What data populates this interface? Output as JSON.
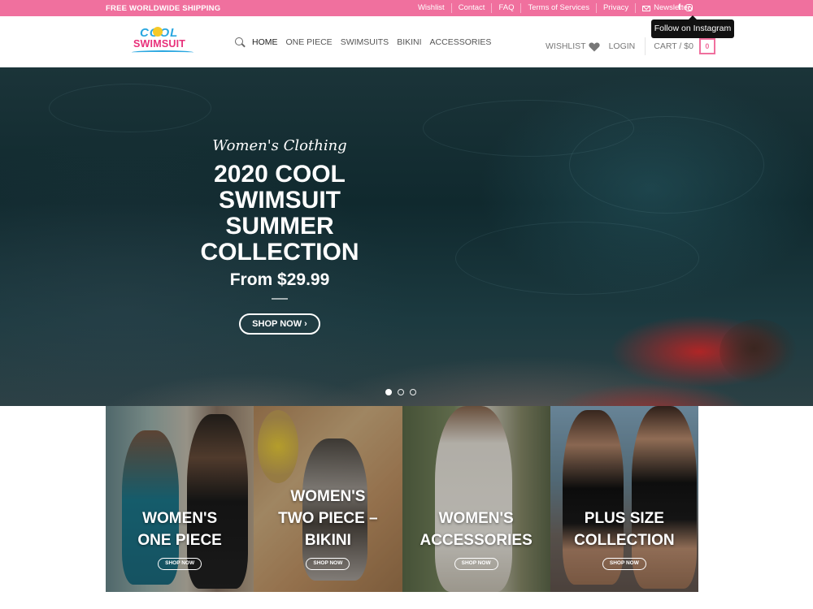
{
  "topbar": {
    "shipping": "FREE WORLDWIDE SHIPPING",
    "links": [
      "Wishlist",
      "Contact",
      "FAQ",
      "Terms of Services",
      "Privacy"
    ],
    "newsletter": "Newsletter",
    "facebook": "f",
    "tooltip": "Follow on Instagram"
  },
  "logo": {
    "top": "COOL",
    "bottom": "SWIMSUIT"
  },
  "nav": {
    "items": [
      "HOME",
      "ONE PIECE",
      "SWIMSUITS",
      "BIKINI",
      "ACCESSORIES"
    ],
    "wishlist": "WISHLIST",
    "login": "LOGIN",
    "cart": "CART / $0",
    "cart_count": "0"
  },
  "hero": {
    "script": "Women's Clothing",
    "title": "2020 COOL SWIMSUIT SUMMER COLLECTION",
    "price": "From $29.99",
    "button": "SHOP NOW ›",
    "slides": 3,
    "active_slide": 1
  },
  "categories": [
    {
      "title_line1": "WOMEN'S",
      "title_line2": "ONE PIECE",
      "button": "SHOP NOW"
    },
    {
      "title_line1": "WOMEN'S",
      "title_line2": "TWO PIECE –",
      "title_line3": "BIKINI",
      "button": "SHOP NOW"
    },
    {
      "title_line1": "WOMEN'S",
      "title_line2": "ACCESSORIES",
      "button": "SHOP NOW"
    },
    {
      "title_line1": "PLUS SIZE",
      "title_line2": "COLLECTION",
      "button": "SHOP NOW"
    }
  ],
  "colors": {
    "brand_pink": "#f0709e"
  }
}
